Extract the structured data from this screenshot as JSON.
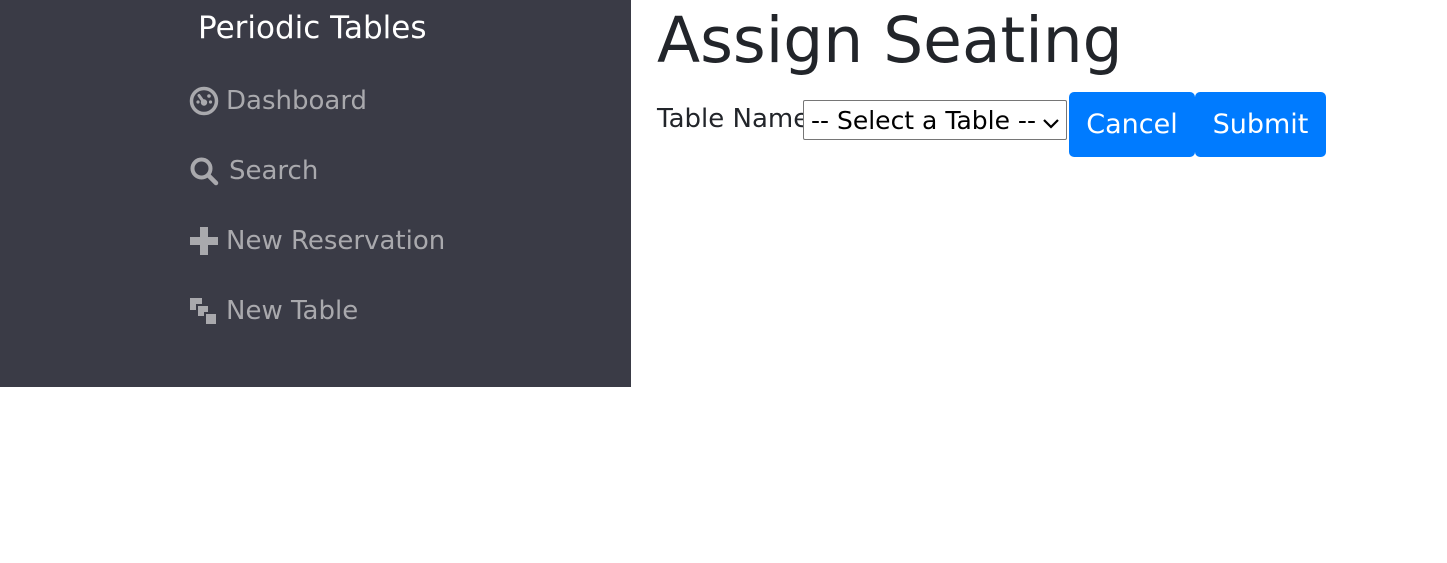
{
  "sidebar": {
    "brand": "Periodic Tables",
    "items": [
      {
        "label": "Dashboard",
        "icon": "dashboard-gauge-icon"
      },
      {
        "label": "Search",
        "icon": "search-icon"
      },
      {
        "label": "New Reservation",
        "icon": "plus-icon"
      },
      {
        "label": "New Table",
        "icon": "layered-squares-icon"
      }
    ],
    "background": "#3a3b46",
    "item_color": "#a9a9ad"
  },
  "main": {
    "title": "Assign Seating",
    "form": {
      "table_label": "Table Name",
      "table_select_value": "-- Select a Table --",
      "cancel_label": "Cancel",
      "submit_label": "Submit"
    },
    "button_color": "#007bff"
  }
}
